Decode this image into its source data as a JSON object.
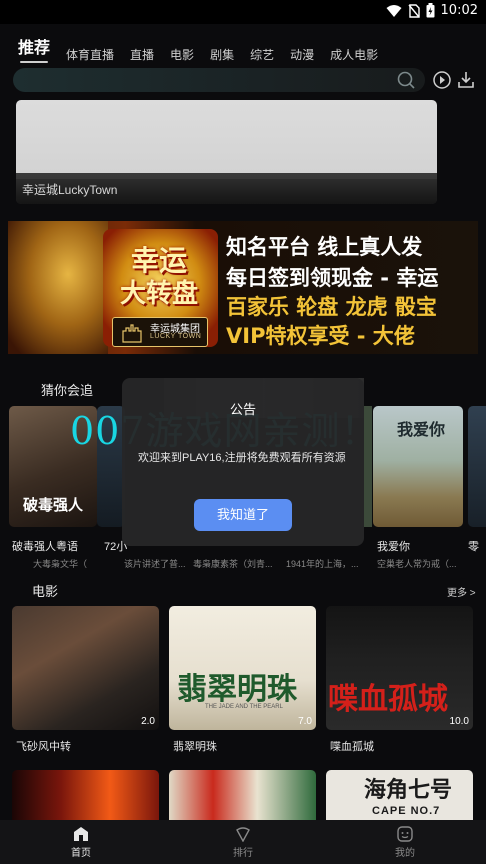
{
  "status_bar": {
    "time": "10:02",
    "icons": [
      "wifi-icon",
      "no-sim-icon",
      "battery-icon"
    ]
  },
  "categories": {
    "active": "推荐",
    "items": [
      "体育直播",
      "直播",
      "电影",
      "剧集",
      "综艺",
      "动漫",
      "成人电影"
    ]
  },
  "search": {
    "placeholder": ""
  },
  "header_icons": [
    "history-icon",
    "download-icon"
  ],
  "banner": {
    "title": "幸运城LuckyTown"
  },
  "ad": {
    "left_title_1": "幸运",
    "left_title_2": "大转盘",
    "logo_text": "幸运城集团",
    "logo_subtext": "LUCKY TOWN",
    "line1": "知名平台 线上真人发",
    "line2": "每日签到领现金 - 幸运",
    "line3": "百家乐 轮盘 龙虎 骰宝",
    "line4": "VIP特权享受 - 大佬"
  },
  "guess_section": {
    "title": "猜你会追",
    "items": [
      {
        "title": "破毒强人粤语",
        "desc": "大毒枭文华（"
      },
      {
        "title": "72小",
        "desc": "该片讲述了普..."
      },
      {
        "title": "",
        "desc": "毒枭康素茶（刘青..."
      },
      {
        "title": "",
        "desc": "1941年的上海，..."
      },
      {
        "title": "我爱你",
        "desc": "空巢老人常为戒（..."
      },
      {
        "title": "零",
        "desc": ""
      }
    ],
    "poster_text_0": "破毒强人",
    "poster_text_4": "我爱你"
  },
  "movie_section": {
    "title": "电影",
    "more": "更多 >",
    "items": [
      {
        "title": "飞砂风中转",
        "score": "2.0"
      },
      {
        "title": "翡翠明珠",
        "score": "7.0",
        "poster_text": "翡翠明珠",
        "poster_sub": "THE JADE AND THE PEARL"
      },
      {
        "title": "喋血孤城",
        "score": "10.0",
        "poster_text": "喋血孤城"
      }
    ],
    "row2_poster_text": "海角七号",
    "row2_poster_sub": "CAPE NO.7"
  },
  "dialog": {
    "title": "公告",
    "body": "欢迎来到PLAY16,注册将免费观看所有资源",
    "button": "我知道了"
  },
  "watermark": "007游戏网亲测！",
  "bottom_nav": [
    {
      "label": "首页",
      "icon": "home-icon",
      "active": true
    },
    {
      "label": "排行",
      "icon": "ranking-icon",
      "active": false
    },
    {
      "label": "我的",
      "icon": "profile-icon",
      "active": false
    }
  ]
}
